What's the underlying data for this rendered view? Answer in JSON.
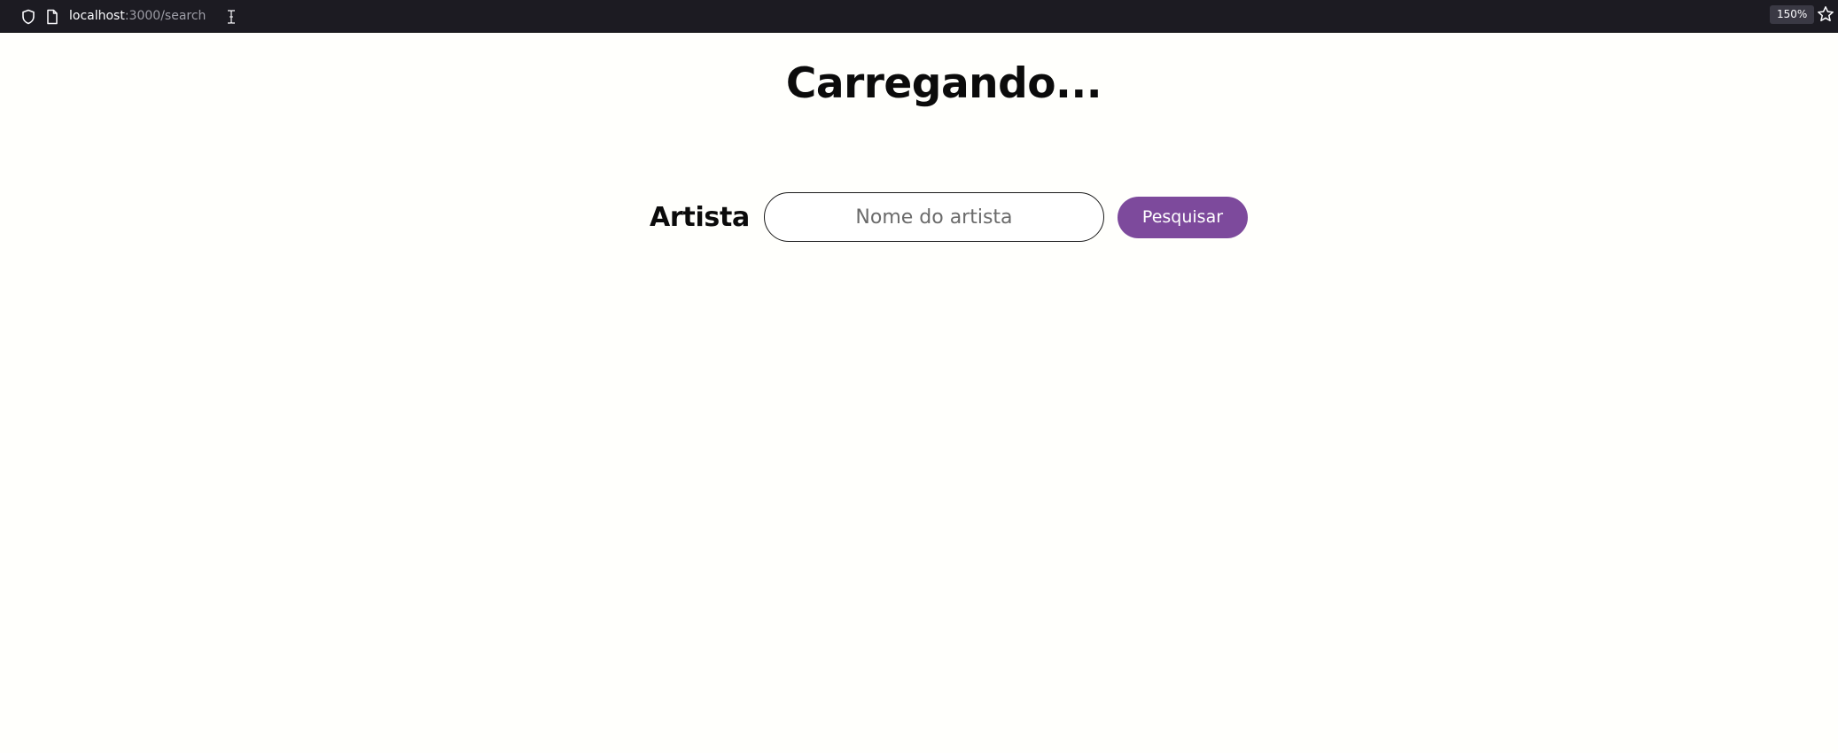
{
  "browser": {
    "url_host": "localhost",
    "url_path": ":3000/search",
    "zoom": "150%"
  },
  "page": {
    "title": "Carregando...",
    "search": {
      "label": "Artista",
      "placeholder": "Nome do artista",
      "value": "",
      "button_label": "Pesquisar"
    }
  },
  "colors": {
    "button_bg": "#7d4a9c",
    "page_bg": "#fffffc",
    "toolbar_bg": "#1c1b22"
  },
  "icons": [
    "shield-icon",
    "page-icon",
    "text-cursor-icon",
    "star-icon"
  ]
}
